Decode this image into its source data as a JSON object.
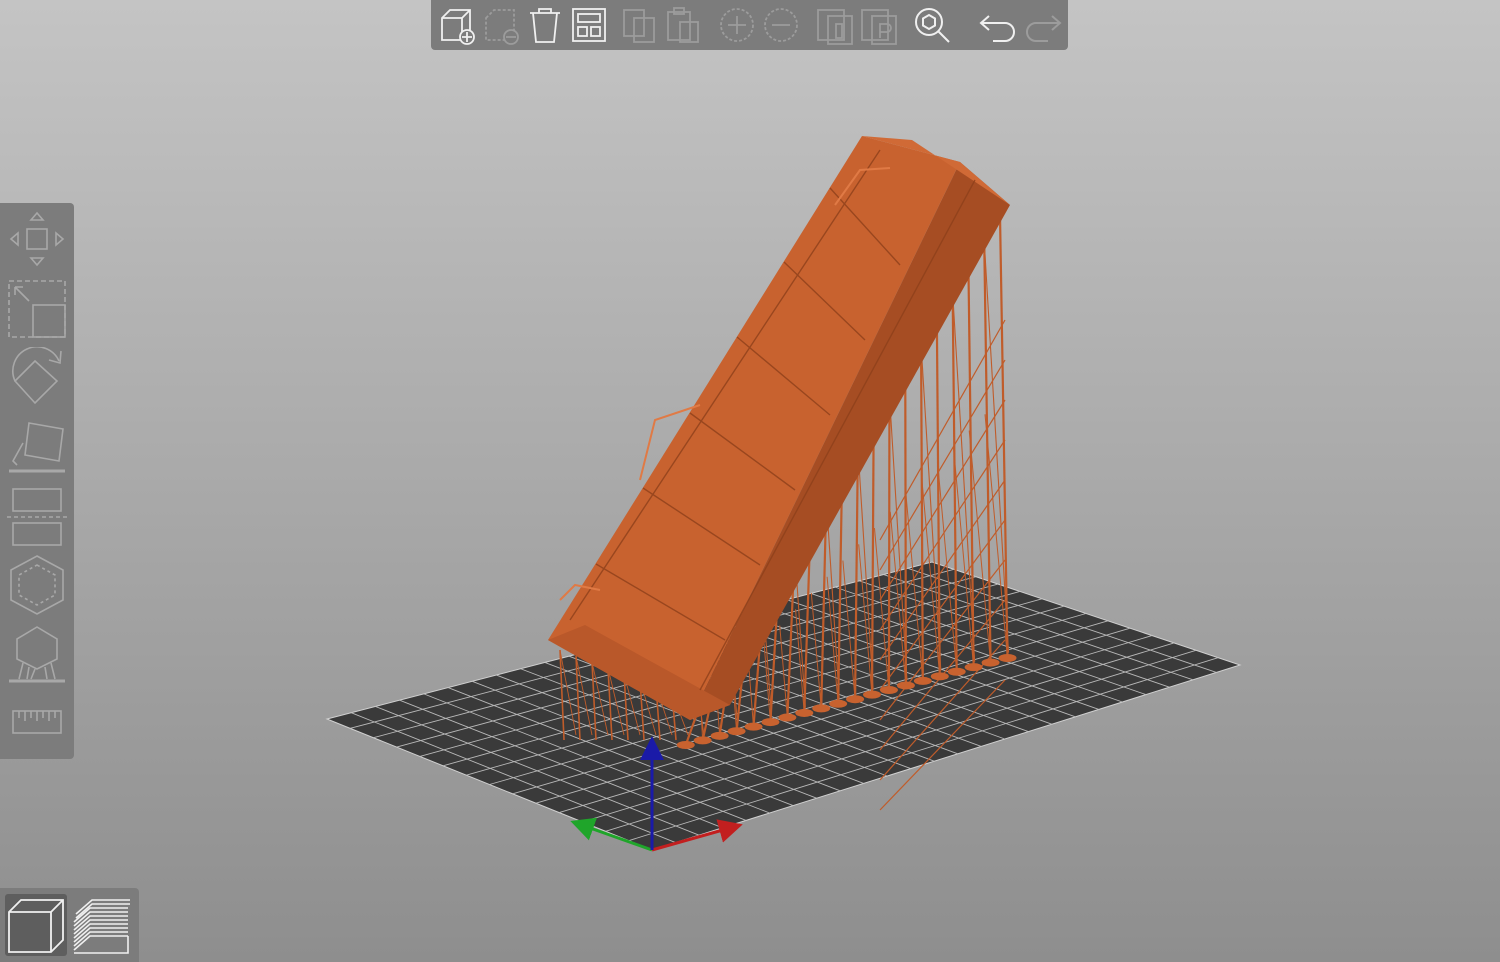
{
  "app": {
    "view_mode": "3d-editor"
  },
  "colors": {
    "model": "#c8622f",
    "model_dark": "#9a4720",
    "bed": "#3a3a3a",
    "bed_grid": "#b4b4b4",
    "toolbar_bg": "#7c7c7c",
    "icon_active": "#f0f0f0",
    "icon_disabled": "#9c9c9c",
    "axis_x": "#c21f1f",
    "axis_y": "#1fa52a",
    "axis_z": "#1a1aa8"
  },
  "top_toolbar": {
    "buttons": [
      {
        "icon": "add-icon",
        "enabled": true
      },
      {
        "icon": "delete-icon",
        "enabled": false
      },
      {
        "icon": "delete-all-icon",
        "enabled": true
      },
      {
        "icon": "arrange-icon",
        "enabled": true
      },
      {
        "icon": "copy-icon",
        "enabled": false
      },
      {
        "icon": "paste-icon",
        "enabled": false
      },
      {
        "icon": "add-instance-icon",
        "enabled": false
      },
      {
        "icon": "remove-instance-icon",
        "enabled": false
      },
      {
        "icon": "split-to-objects-icon",
        "enabled": false
      },
      {
        "icon": "split-to-parts-icon",
        "enabled": false
      },
      {
        "icon": "search-icon",
        "enabled": true
      },
      {
        "icon": "undo-icon",
        "enabled": true
      },
      {
        "icon": "redo-icon",
        "enabled": false
      }
    ]
  },
  "left_toolbar": {
    "tools": [
      {
        "icon": "move-icon"
      },
      {
        "icon": "scale-icon"
      },
      {
        "icon": "rotate-icon"
      },
      {
        "icon": "place-on-face-icon"
      },
      {
        "icon": "cut-icon"
      },
      {
        "icon": "hollow-icon"
      },
      {
        "icon": "sla-support-points-icon"
      },
      {
        "icon": "measure-icon"
      }
    ]
  },
  "view_toolbar": {
    "buttons": [
      {
        "icon": "3d-view-icon",
        "active": true
      },
      {
        "icon": "preview-layers-icon",
        "active": false
      }
    ]
  }
}
